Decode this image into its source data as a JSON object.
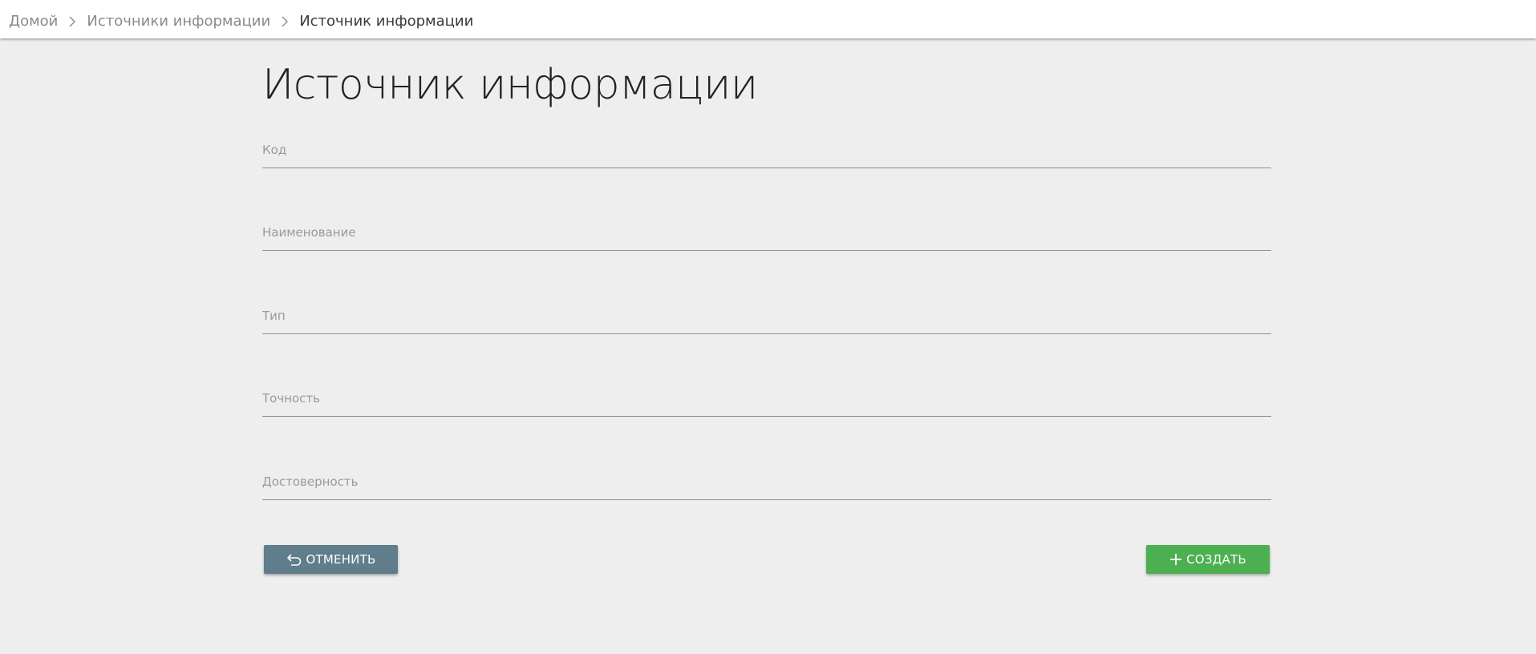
{
  "breadcrumb": {
    "home": "Домой",
    "parent": "Источники информации",
    "current": "Источник информации"
  },
  "page": {
    "title": "Источник информации"
  },
  "form": {
    "fields": [
      {
        "label": "Код",
        "value": ""
      },
      {
        "label": "Наименование",
        "value": ""
      },
      {
        "label": "Тип",
        "value": ""
      },
      {
        "label": "Точность",
        "value": ""
      },
      {
        "label": "Достоверность",
        "value": ""
      }
    ]
  },
  "actions": {
    "cancel_label": "ОТМЕНИТЬ",
    "create_label": "СОЗДАТЬ",
    "cancel_icon": "undo-arrow-icon",
    "create_icon": "plus-icon",
    "cancel_color": "#607d8b",
    "create_color": "#4caf50"
  }
}
